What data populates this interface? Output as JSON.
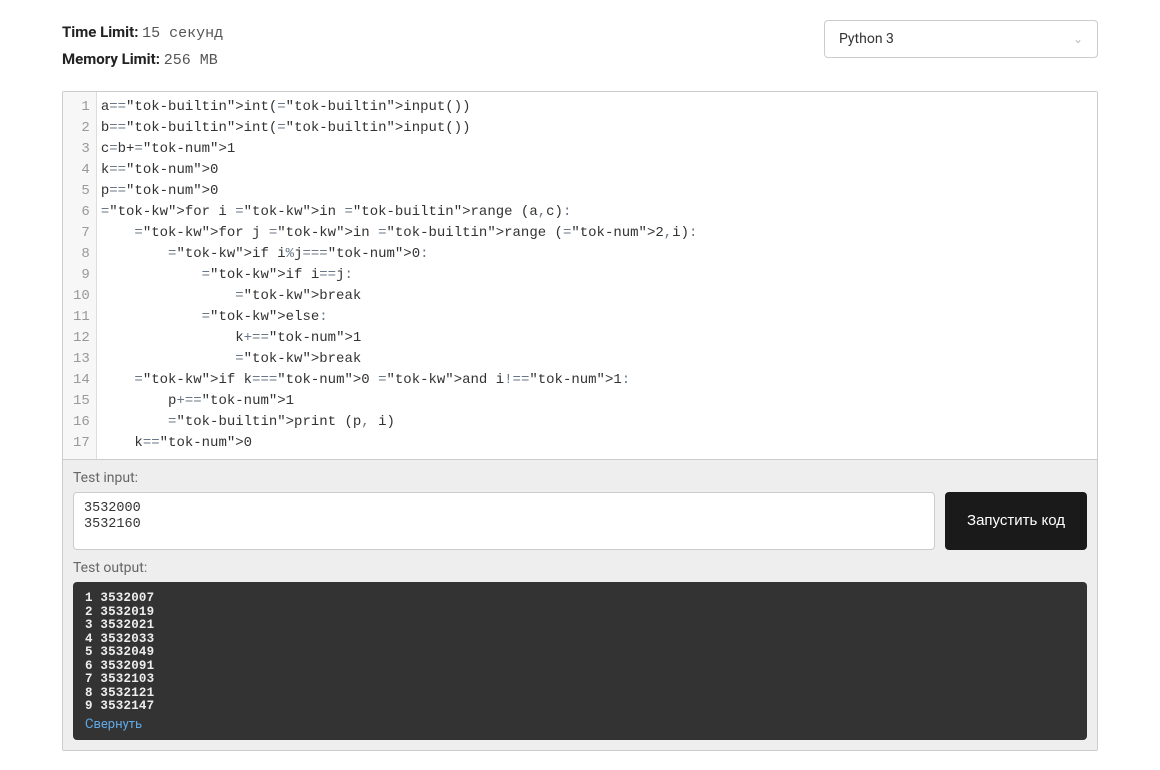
{
  "limits": {
    "time_label": "Time Limit:",
    "time_value": "15 секунд",
    "memory_label": "Memory Limit:",
    "memory_value": "256 MB"
  },
  "language_selector": {
    "selected": "Python 3"
  },
  "code": {
    "line_count": 17,
    "lines": [
      "a=int(input())",
      "b=int(input())",
      "c=b+1",
      "k=0",
      "p=0",
      "for i in range (a,c):",
      "    for j in range (2,i):",
      "        if i%j==0:",
      "            if i==j:",
      "                break",
      "            else:",
      "                k+=1",
      "                break",
      "    if k==0 and i!=1:",
      "        p+=1",
      "        print (p, i)",
      "    k=0"
    ]
  },
  "test": {
    "input_label": "Test input:",
    "input_value": "3532000\n3532160",
    "run_button": "Запустить код",
    "output_label": "Test output:",
    "output_lines": [
      "1 3532007",
      "2 3532019",
      "3 3532021",
      "4 3532033",
      "5 3532049",
      "6 3532091",
      "7 3532103",
      "8 3532121",
      "9 3532147"
    ],
    "collapse_label": "Свернуть"
  }
}
